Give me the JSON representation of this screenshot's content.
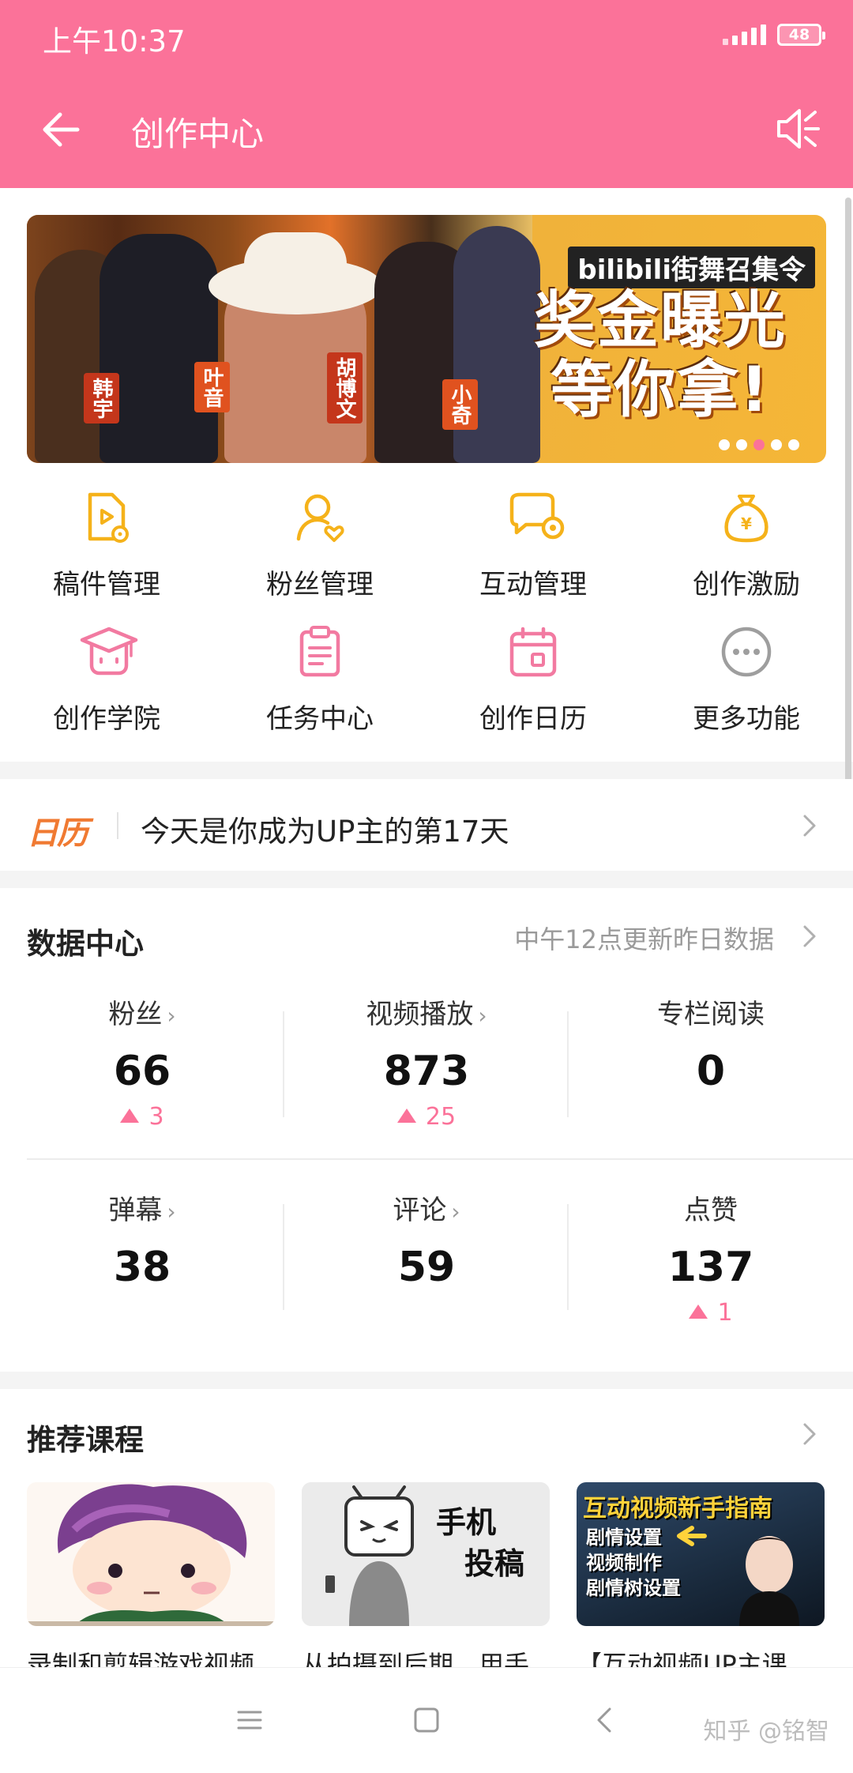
{
  "status_bar": {
    "time": "上午10:37",
    "battery": "48"
  },
  "header": {
    "title": "创作中心"
  },
  "banner": {
    "headline_line1": "奖金曝光",
    "headline_line2": "等你拿!",
    "tagline": "bilibili街舞召集令",
    "names": [
      "韩宇",
      "叶音",
      "胡博文",
      "小奇"
    ],
    "slides": 5,
    "active_slide": 3
  },
  "quick_actions": [
    {
      "label": "稿件管理",
      "icon": "manuscript-icon"
    },
    {
      "label": "粉丝管理",
      "icon": "fans-icon"
    },
    {
      "label": "互动管理",
      "icon": "interaction-icon"
    },
    {
      "label": "创作激励",
      "icon": "money-bag-icon"
    },
    {
      "label": "创作学院",
      "icon": "academy-icon"
    },
    {
      "label": "任务中心",
      "icon": "clipboard-icon"
    },
    {
      "label": "创作日历",
      "icon": "calendar-icon"
    },
    {
      "label": "更多功能",
      "icon": "more-icon"
    }
  ],
  "calendar": {
    "badge": "日历",
    "text": "今天是你成为UP主的第17天"
  },
  "data_center": {
    "title": "数据中心",
    "update_note": "中午12点更新昨日数据",
    "stats": [
      {
        "label": "粉丝",
        "value": "66",
        "delta": "3"
      },
      {
        "label": "视频播放",
        "value": "873",
        "delta": "25"
      },
      {
        "label": "专栏阅读",
        "value": "0",
        "delta": ""
      },
      {
        "label": "弹幕",
        "value": "38",
        "delta": ""
      },
      {
        "label": "评论",
        "value": "59",
        "delta": ""
      },
      {
        "label": "点赞",
        "value": "137",
        "delta": "1"
      }
    ]
  },
  "courses": {
    "title": "推荐课程",
    "items": [
      {
        "title": "录制和剪辑游戏视频",
        "thumb_text": ""
      },
      {
        "title": "从拍摄到后期，用手",
        "thumb_text_1": "手机",
        "thumb_text_2": "投稿"
      },
      {
        "title": "【互动视频UP主课",
        "thumb_heading": "互动视频新手指南",
        "thumb_lines": [
          "剧情设置",
          "视频制作",
          "剧情树设置"
        ]
      }
    ]
  },
  "watermark": "知乎 @铭智",
  "colors": {
    "brand": "#fb7299",
    "icon_yellow": "#f5b21a",
    "icon_pink": "#f27aa1",
    "icon_gray": "#9e9e9e"
  }
}
